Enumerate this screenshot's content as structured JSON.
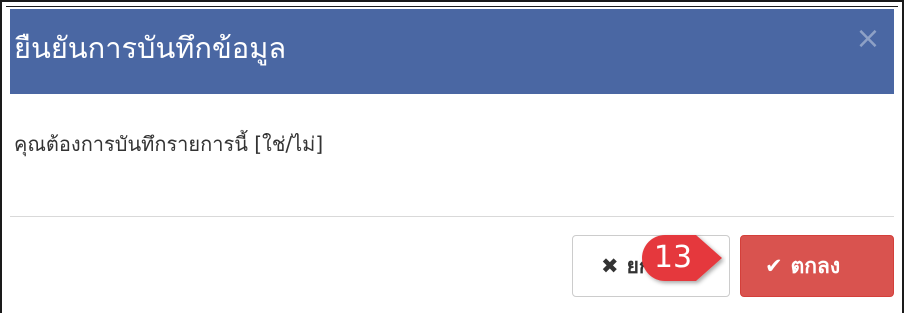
{
  "dialog": {
    "title": "ยืนยันการบันทึกข้อมูล",
    "close_symbol": "×",
    "message": "คุณต้องการบันทึกรายการนี้ [ใช่/ไม่]",
    "cancel_button": {
      "label": "ยกเลิก",
      "icon": "times-icon",
      "icon_symbol": "✖"
    },
    "ok_button": {
      "label": "ตกลง",
      "icon": "check-icon",
      "icon_symbol": "✔"
    }
  },
  "step_callout": {
    "number": "13"
  },
  "colors": {
    "header": "#4a67a3",
    "ok_button": "#d9534f",
    "callout": "#e5393c"
  }
}
